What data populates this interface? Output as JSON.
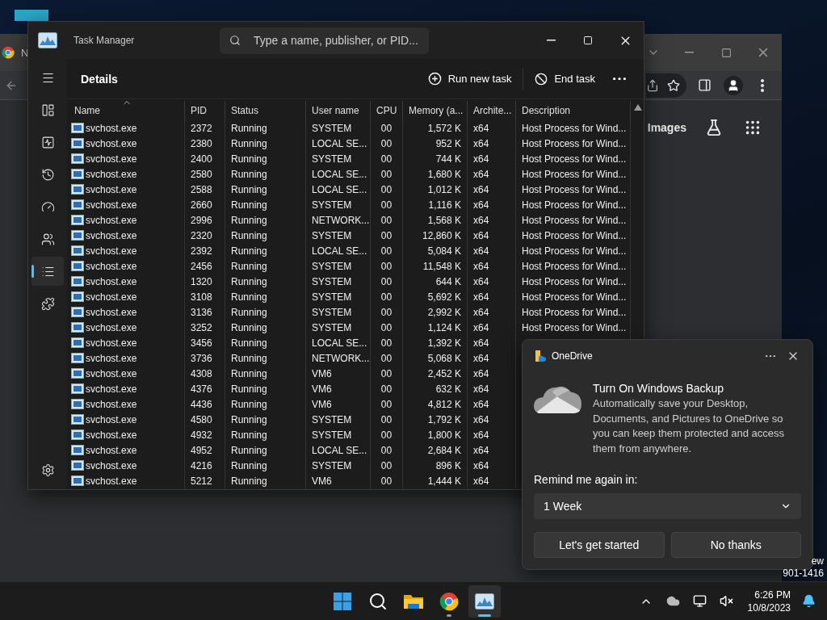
{
  "desktop": {
    "corner_text": [
      "ew",
      "901-1416"
    ]
  },
  "browser": {
    "tab_title": "N",
    "links": [
      "Images"
    ]
  },
  "task_manager": {
    "title": "Task Manager",
    "search": {
      "placeholder": "Type a name, publisher, or PID..."
    },
    "nav": [
      {
        "kind": "menu",
        "selected": false
      },
      {
        "kind": "processes",
        "selected": false
      },
      {
        "kind": "performance",
        "selected": false
      },
      {
        "kind": "history",
        "selected": false
      },
      {
        "kind": "startup",
        "selected": false
      },
      {
        "kind": "users",
        "selected": false
      },
      {
        "kind": "details",
        "selected": true
      },
      {
        "kind": "services",
        "selected": false
      },
      {
        "kind": "settings",
        "selected": false
      }
    ],
    "page_title": "Details",
    "actions": [
      {
        "kind": "run",
        "label": "Run new task"
      },
      {
        "kind": "end",
        "label": "End task"
      }
    ],
    "columns": [
      {
        "label": "Name",
        "sorted": true
      },
      {
        "label": "PID",
        "sorted": false
      },
      {
        "label": "Status",
        "sorted": false
      },
      {
        "label": "User name",
        "sorted": false
      },
      {
        "label": "CPU",
        "sorted": false
      },
      {
        "label": "Memory (a...",
        "sorted": false
      },
      {
        "label": "Archite...",
        "sorted": false
      },
      {
        "label": "Description",
        "sorted": false
      }
    ],
    "rows": [
      {
        "name": "svchost.exe",
        "pid": "2372",
        "status": "Running",
        "user": "SYSTEM",
        "cpu": "00",
        "memory": "1,572 K",
        "arch": "x64",
        "description": "Host Process for Wind..."
      },
      {
        "name": "svchost.exe",
        "pid": "2380",
        "status": "Running",
        "user": "LOCAL SE...",
        "cpu": "00",
        "memory": "952 K",
        "arch": "x64",
        "description": "Host Process for Wind..."
      },
      {
        "name": "svchost.exe",
        "pid": "2400",
        "status": "Running",
        "user": "SYSTEM",
        "cpu": "00",
        "memory": "744 K",
        "arch": "x64",
        "description": "Host Process for Wind..."
      },
      {
        "name": "svchost.exe",
        "pid": "2580",
        "status": "Running",
        "user": "LOCAL SE...",
        "cpu": "00",
        "memory": "1,680 K",
        "arch": "x64",
        "description": "Host Process for Wind..."
      },
      {
        "name": "svchost.exe",
        "pid": "2588",
        "status": "Running",
        "user": "LOCAL SE...",
        "cpu": "00",
        "memory": "1,012 K",
        "arch": "x64",
        "description": "Host Process for Wind..."
      },
      {
        "name": "svchost.exe",
        "pid": "2660",
        "status": "Running",
        "user": "SYSTEM",
        "cpu": "00",
        "memory": "1,116 K",
        "arch": "x64",
        "description": "Host Process for Wind..."
      },
      {
        "name": "svchost.exe",
        "pid": "2996",
        "status": "Running",
        "user": "NETWORK...",
        "cpu": "00",
        "memory": "1,568 K",
        "arch": "x64",
        "description": "Host Process for Wind..."
      },
      {
        "name": "svchost.exe",
        "pid": "2320",
        "status": "Running",
        "user": "SYSTEM",
        "cpu": "00",
        "memory": "12,860 K",
        "arch": "x64",
        "description": "Host Process for Wind..."
      },
      {
        "name": "svchost.exe",
        "pid": "2392",
        "status": "Running",
        "user": "LOCAL SE...",
        "cpu": "00",
        "memory": "5,084 K",
        "arch": "x64",
        "description": "Host Process for Wind..."
      },
      {
        "name": "svchost.exe",
        "pid": "2456",
        "status": "Running",
        "user": "SYSTEM",
        "cpu": "00",
        "memory": "11,548 K",
        "arch": "x64",
        "description": "Host Process for Wind..."
      },
      {
        "name": "svchost.exe",
        "pid": "1320",
        "status": "Running",
        "user": "SYSTEM",
        "cpu": "00",
        "memory": "644 K",
        "arch": "x64",
        "description": "Host Process for Wind..."
      },
      {
        "name": "svchost.exe",
        "pid": "3108",
        "status": "Running",
        "user": "SYSTEM",
        "cpu": "00",
        "memory": "5,692 K",
        "arch": "x64",
        "description": "Host Process for Wind..."
      },
      {
        "name": "svchost.exe",
        "pid": "3136",
        "status": "Running",
        "user": "SYSTEM",
        "cpu": "00",
        "memory": "2,992 K",
        "arch": "x64",
        "description": "Host Process for Wind..."
      },
      {
        "name": "svchost.exe",
        "pid": "3252",
        "status": "Running",
        "user": "SYSTEM",
        "cpu": "00",
        "memory": "1,124 K",
        "arch": "x64",
        "description": "Host Process for Wind..."
      },
      {
        "name": "svchost.exe",
        "pid": "3456",
        "status": "Running",
        "user": "LOCAL SE...",
        "cpu": "00",
        "memory": "1,392 K",
        "arch": "x64"
      },
      {
        "name": "svchost.exe",
        "pid": "3736",
        "status": "Running",
        "user": "NETWORK...",
        "cpu": "00",
        "memory": "5,068 K",
        "arch": "x64"
      },
      {
        "name": "svchost.exe",
        "pid": "4308",
        "status": "Running",
        "user": "VM6",
        "cpu": "00",
        "memory": "2,452 K",
        "arch": "x64"
      },
      {
        "name": "svchost.exe",
        "pid": "4376",
        "status": "Running",
        "user": "VM6",
        "cpu": "00",
        "memory": "632 K",
        "arch": "x64"
      },
      {
        "name": "svchost.exe",
        "pid": "4436",
        "status": "Running",
        "user": "VM6",
        "cpu": "00",
        "memory": "4,812 K",
        "arch": "x64"
      },
      {
        "name": "svchost.exe",
        "pid": "4580",
        "status": "Running",
        "user": "SYSTEM",
        "cpu": "00",
        "memory": "1,792 K",
        "arch": "x64"
      },
      {
        "name": "svchost.exe",
        "pid": "4932",
        "status": "Running",
        "user": "SYSTEM",
        "cpu": "00",
        "memory": "1,800 K",
        "arch": "x64"
      },
      {
        "name": "svchost.exe",
        "pid": "4952",
        "status": "Running",
        "user": "LOCAL SE...",
        "cpu": "00",
        "memory": "2,684 K",
        "arch": "x64"
      },
      {
        "name": "svchost.exe",
        "pid": "4216",
        "status": "Running",
        "user": "SYSTEM",
        "cpu": "00",
        "memory": "896 K",
        "arch": "x64"
      },
      {
        "name": "svchost.exe",
        "pid": "5212",
        "status": "Running",
        "user": "VM6",
        "cpu": "00",
        "memory": "1,444 K",
        "arch": "x64"
      }
    ]
  },
  "notification": {
    "app": "OneDrive",
    "title": "Turn On Windows Backup",
    "body": "Automatically save your Desktop, Documents, and Pictures to OneDrive so you can keep them protected and access them from anywhere.",
    "remind_label": "Remind me again in:",
    "remind_value": "1 Week",
    "buttons": [
      "Let's get started",
      "No thanks"
    ]
  },
  "taskbar": {
    "apps": [
      {
        "kind": "start",
        "running": false,
        "active": false
      },
      {
        "kind": "search",
        "running": false,
        "active": false
      },
      {
        "kind": "explorer",
        "running": false,
        "active": false
      },
      {
        "kind": "chrome",
        "running": true,
        "active": false
      },
      {
        "kind": "taskmanager",
        "running": true,
        "active": true
      }
    ],
    "time": "6:26 PM",
    "date": "10/8/2023"
  }
}
